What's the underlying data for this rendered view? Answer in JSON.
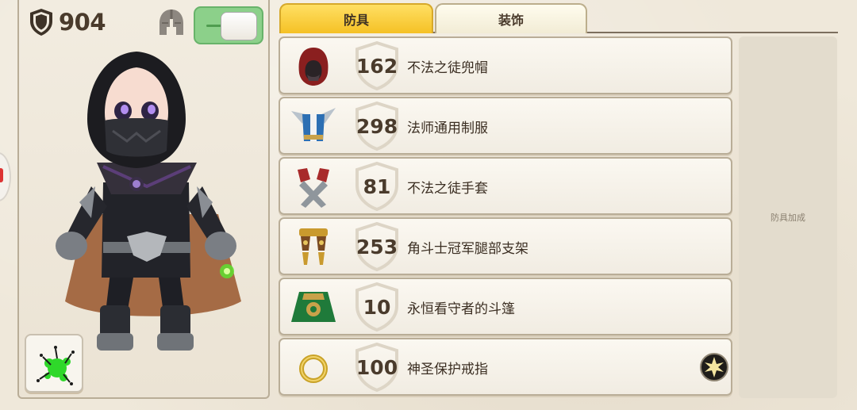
{
  "character_panel": {
    "armor_total": "904",
    "helmet_visible": true
  },
  "tabs": [
    {
      "label": "防具",
      "active": true
    },
    {
      "label": "装饰",
      "active": false
    }
  ],
  "armor_items": [
    {
      "value": "162",
      "name": "不法之徒兜帽",
      "icon": "hood-icon"
    },
    {
      "value": "298",
      "name": "法师通用制服",
      "icon": "mage-uniform-icon"
    },
    {
      "value": "81",
      "name": "不法之徒手套",
      "icon": "gloves-icon"
    },
    {
      "value": "253",
      "name": "角斗士冠军腿部支架",
      "icon": "leg-brace-icon"
    },
    {
      "value": "10",
      "name": "永恒看守者的斗篷",
      "icon": "cape-icon"
    },
    {
      "value": "100",
      "name": "神圣保护戒指",
      "icon": "ring-icon",
      "enchanted": true
    }
  ],
  "bonus_panel": {
    "label": "防具加成"
  },
  "colors": {
    "active_tab": "#f5c125",
    "toggle_on": "#8cd08a",
    "panel_border": "#b9ad97"
  }
}
